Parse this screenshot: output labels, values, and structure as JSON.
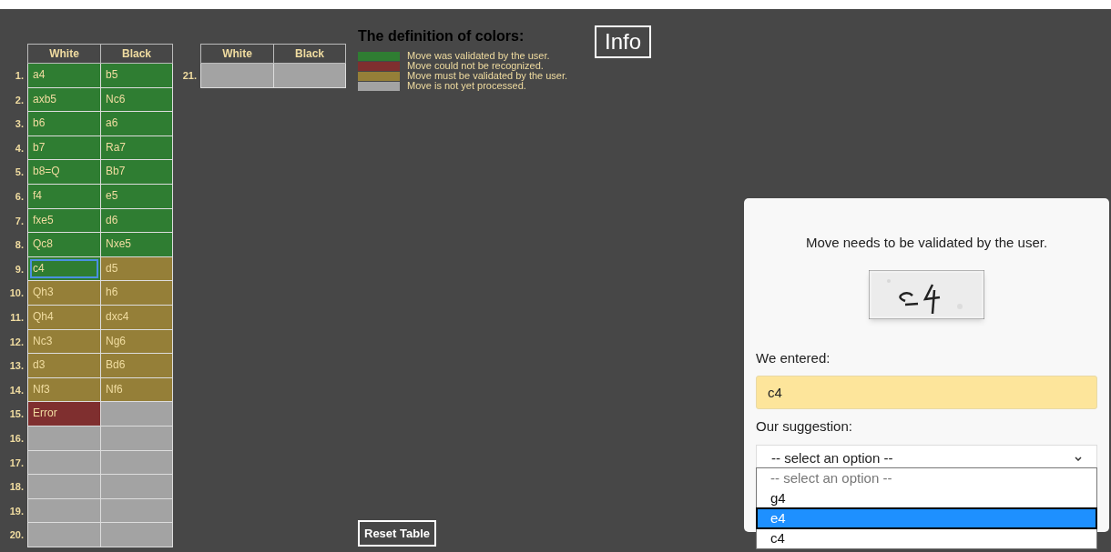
{
  "moves_table": {
    "columns": [
      "White",
      "Black"
    ],
    "rows": [
      {
        "number": "1.",
        "cells": [
          {
            "text": "a4",
            "color": "#2f7d32",
            "focused": false
          },
          {
            "text": "b5",
            "color": "#2f7d32",
            "focused": false
          }
        ]
      },
      {
        "number": "2.",
        "cells": [
          {
            "text": "axb5",
            "color": "#2f7d32",
            "focused": false
          },
          {
            "text": "Nc6",
            "color": "#2f7d32",
            "focused": false
          }
        ]
      },
      {
        "number": "3.",
        "cells": [
          {
            "text": "b6",
            "color": "#2f7d32",
            "focused": false
          },
          {
            "text": "a6",
            "color": "#2f7d32",
            "focused": false
          }
        ]
      },
      {
        "number": "4.",
        "cells": [
          {
            "text": "b7",
            "color": "#2f7d32",
            "focused": false
          },
          {
            "text": "Ra7",
            "color": "#2f7d32",
            "focused": false
          }
        ]
      },
      {
        "number": "5.",
        "cells": [
          {
            "text": "b8=Q",
            "color": "#2f7d32",
            "focused": false
          },
          {
            "text": "Bb7",
            "color": "#2f7d32",
            "focused": false
          }
        ]
      },
      {
        "number": "6.",
        "cells": [
          {
            "text": "f4",
            "color": "#2f7d32",
            "focused": false
          },
          {
            "text": "e5",
            "color": "#2f7d32",
            "focused": false
          }
        ]
      },
      {
        "number": "7.",
        "cells": [
          {
            "text": "fxe5",
            "color": "#2f7d32",
            "focused": false
          },
          {
            "text": "d6",
            "color": "#2f7d32",
            "focused": false
          }
        ]
      },
      {
        "number": "8.",
        "cells": [
          {
            "text": "Qc8",
            "color": "#2f7d32",
            "focused": false
          },
          {
            "text": "Nxe5",
            "color": "#2f7d32",
            "focused": false
          }
        ]
      },
      {
        "number": "9.",
        "cells": [
          {
            "text": "c4",
            "color": "#2f7d32",
            "focused": true
          },
          {
            "text": "d5",
            "color": "#957f38",
            "focused": false
          }
        ]
      },
      {
        "number": "10.",
        "cells": [
          {
            "text": "Qh3",
            "color": "#957f38",
            "focused": false
          },
          {
            "text": "h6",
            "color": "#957f38",
            "focused": false
          }
        ]
      },
      {
        "number": "11.",
        "cells": [
          {
            "text": "Qh4",
            "color": "#957f38",
            "focused": false
          },
          {
            "text": "dxc4",
            "color": "#957f38",
            "focused": false
          }
        ]
      },
      {
        "number": "12.",
        "cells": [
          {
            "text": "Nc3",
            "color": "#957f38",
            "focused": false
          },
          {
            "text": "Ng6",
            "color": "#957f38",
            "focused": false
          }
        ]
      },
      {
        "number": "13.",
        "cells": [
          {
            "text": "d3",
            "color": "#957f38",
            "focused": false
          },
          {
            "text": "Bd6",
            "color": "#957f38",
            "focused": false
          }
        ]
      },
      {
        "number": "14.",
        "cells": [
          {
            "text": "Nf3",
            "color": "#957f38",
            "focused": false
          },
          {
            "text": "Nf6",
            "color": "#957f38",
            "focused": false
          }
        ]
      },
      {
        "number": "15.",
        "cells": [
          {
            "text": "Error",
            "color": "#7f2f2f",
            "focused": false
          },
          {
            "color": "#a3a3a3",
            "focused": false
          }
        ]
      },
      {
        "number": "16.",
        "cells": [
          {
            "color": "#a3a3a3",
            "focused": false
          },
          {
            "color": "#a3a3a3",
            "focused": false
          }
        ]
      },
      {
        "number": "17.",
        "cells": [
          {
            "color": "#a3a3a3",
            "focused": false
          },
          {
            "color": "#a3a3a3",
            "focused": false
          }
        ]
      },
      {
        "number": "18.",
        "cells": [
          {
            "color": "#a3a3a3",
            "focused": false
          },
          {
            "color": "#a3a3a3",
            "focused": false
          }
        ]
      },
      {
        "number": "19.",
        "cells": [
          {
            "color": "#a3a3a3",
            "focused": false
          },
          {
            "color": "#a3a3a3",
            "focused": false
          }
        ]
      },
      {
        "number": "20.",
        "cells": [
          {
            "color": "#a3a3a3",
            "focused": false
          },
          {
            "color": "#a3a3a3",
            "focused": false
          }
        ]
      }
    ]
  },
  "moves_table_2": {
    "columns": [
      "White",
      "Black"
    ],
    "rows": [
      {
        "number": "21.",
        "cells": [
          {
            "color": "#a3a3a3",
            "focused": false
          },
          {
            "color": "#a3a3a3",
            "focused": false
          }
        ]
      }
    ]
  },
  "legend": {
    "title": "The definition of colors:",
    "items": [
      {
        "color": "#2f7d32",
        "label": "Move was validated by the user."
      },
      {
        "color": "#7f2f2f",
        "label": "Move could not be recognized."
      },
      {
        "color": "#957f38",
        "label": "Move must be validated by the user."
      },
      {
        "color": "#a3a3a3",
        "label": "Move is not yet processed."
      }
    ]
  },
  "info_button": "Info",
  "reset_button": "Reset Table",
  "validation_panel": {
    "message": "Move needs to be validated by the user.",
    "entered_label": "We entered:",
    "entered_value": "c4",
    "suggestion_label": "Our suggestion:",
    "suggestion_value": "-- select an option --",
    "options": [
      {
        "label": "-- select an option --",
        "selected": false,
        "disabled": true
      },
      {
        "label": "g4",
        "selected": false,
        "disabled": false
      },
      {
        "label": "e4",
        "selected": true,
        "disabled": false
      },
      {
        "label": "c4",
        "selected": false,
        "disabled": false
      }
    ]
  }
}
